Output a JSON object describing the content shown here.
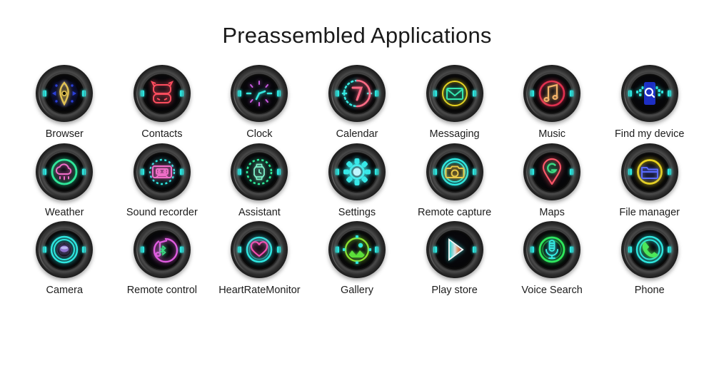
{
  "page": {
    "title": "Preassembled Applications",
    "background_color": "#ffffff",
    "text_color": "#1d1d1d"
  },
  "apps": {
    "rows": [
      [
        {
          "label": "Browser",
          "icon": "compass-icon",
          "ring_color": "#2a3fd8",
          "glyph_color": "#e3c352"
        },
        {
          "label": "Contacts",
          "icon": "robot-face-icon",
          "ring_color": "#7a1020",
          "glyph_color": "#ff4d5e"
        },
        {
          "label": "Clock",
          "icon": "clock-icon",
          "ring_color": "#c85ae0",
          "glyph_color": "#35e8e0"
        },
        {
          "label": "Calendar",
          "icon": "calendar-7-icon",
          "ring_color": "#35e8e0",
          "glyph_color": "#ff6b85"
        },
        {
          "label": "Messaging",
          "icon": "envelope-icon",
          "ring_color": "#e8d21f",
          "glyph_color": "#35e8b0"
        },
        {
          "label": "Music",
          "icon": "music-note-icon",
          "ring_color": "#e0304f",
          "glyph_color": "#f3b36a"
        },
        {
          "label": "Find my device",
          "icon": "phone-search-icon",
          "ring_color": "#2ee6e0",
          "glyph_color": "#ffffff"
        }
      ],
      [
        {
          "label": "Weather",
          "icon": "cloud-rain-icon",
          "ring_color": "#2ee89a",
          "glyph_color": "#f06ec8"
        },
        {
          "label": "Sound recorder",
          "icon": "cassette-icon",
          "ring_color": "#2ee6e0",
          "glyph_color": "#f06ec8"
        },
        {
          "label": "Assistant",
          "icon": "watch-icon",
          "ring_color": "#2ee89a",
          "glyph_color": "#7df0c8"
        },
        {
          "label": "Settings",
          "icon": "gear-icon",
          "ring_color": "#35e8e8",
          "glyph_color": "#bff6ff"
        },
        {
          "label": "Remote capture",
          "icon": "camera-icon",
          "ring_color": "#2ee6e0",
          "glyph_color": "#e8c84a"
        },
        {
          "label": "Maps",
          "icon": "map-pin-icon",
          "ring_color": "#ff5568",
          "glyph_color": "#3ddc84"
        },
        {
          "label": "File manager",
          "icon": "folder-icon",
          "ring_color": "#e8d21f",
          "glyph_color": "#5a6bff"
        }
      ],
      [
        {
          "label": "Camera",
          "icon": "aperture-icon",
          "ring_color": "#2ee6e0",
          "glyph_color": "#9b7ce0"
        },
        {
          "label": "Remote control",
          "icon": "bluetooth-note-icon",
          "ring_color": "#e05ce0",
          "glyph_color": "#3ddc84"
        },
        {
          "label": "HeartRateMonitor",
          "icon": "heart-icon",
          "ring_color": "#2ee6e0",
          "glyph_color": "#f050b0"
        },
        {
          "label": "Gallery",
          "icon": "photo-icon",
          "ring_color": "#8ae02e",
          "glyph_color": "#5ce03a"
        },
        {
          "label": "Play store",
          "icon": "play-icon",
          "ring_color": "#2ee6e0",
          "glyph_color": "#f5f5f5"
        },
        {
          "label": "Voice Search",
          "icon": "microphone-icon",
          "ring_color": "#2ee85a",
          "glyph_color": "#35e8e0"
        },
        {
          "label": "Phone",
          "icon": "handset-icon",
          "ring_color": "#2ee6e0",
          "glyph_color": "#4ce85a"
        }
      ]
    ]
  }
}
